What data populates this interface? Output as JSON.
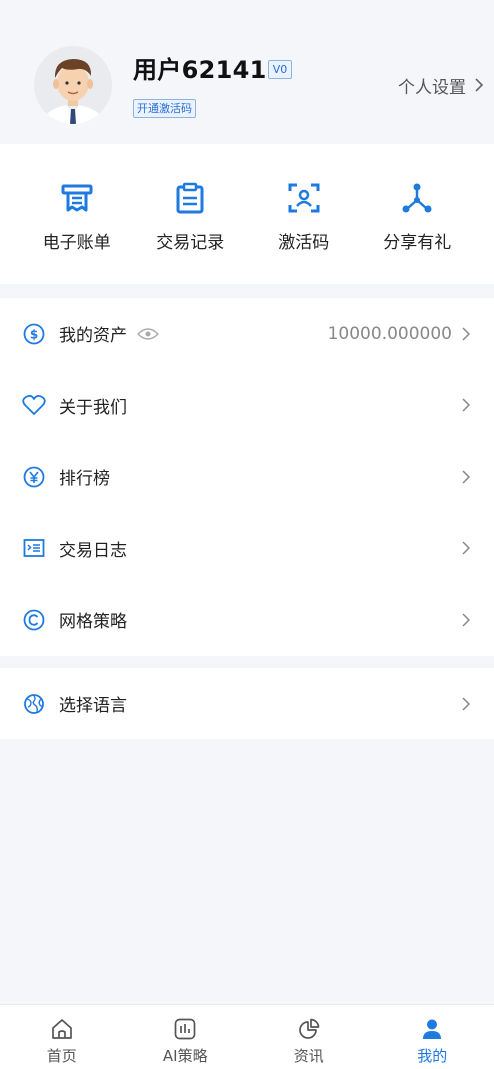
{
  "profile": {
    "username": "用户62141",
    "level_badge": "V0",
    "activate_badge": "开通激活码",
    "settings_label": "个人设置"
  },
  "quick_actions": [
    {
      "label": "电子账单",
      "icon": "receipt-icon"
    },
    {
      "label": "交易记录",
      "icon": "clipboard-icon"
    },
    {
      "label": "激活码",
      "icon": "scan-user-icon"
    },
    {
      "label": "分享有礼",
      "icon": "share-nodes-icon"
    }
  ],
  "menu": {
    "assets": {
      "label": "我的资产",
      "value": "10000.000000",
      "icon": "dollar-circle-icon"
    },
    "about": {
      "label": "关于我们",
      "icon": "heart-icon"
    },
    "ranking": {
      "label": "排行榜",
      "icon": "yen-circle-icon"
    },
    "trade_log": {
      "label": "交易日志",
      "icon": "log-list-icon"
    },
    "grid_strategy": {
      "label": "网格策略",
      "icon": "copyright-circle-icon"
    },
    "language": {
      "label": "选择语言",
      "icon": "globe-icon"
    }
  },
  "tabs": [
    {
      "label": "首页",
      "icon": "home-icon",
      "active": false
    },
    {
      "label": "AI策略",
      "icon": "chart-icon",
      "active": false
    },
    {
      "label": "资讯",
      "icon": "pie-icon",
      "active": false
    },
    {
      "label": "我的",
      "icon": "user-icon",
      "active": true
    }
  ],
  "colors": {
    "accent": "#1f7ae0",
    "background": "#f5f6fa"
  }
}
